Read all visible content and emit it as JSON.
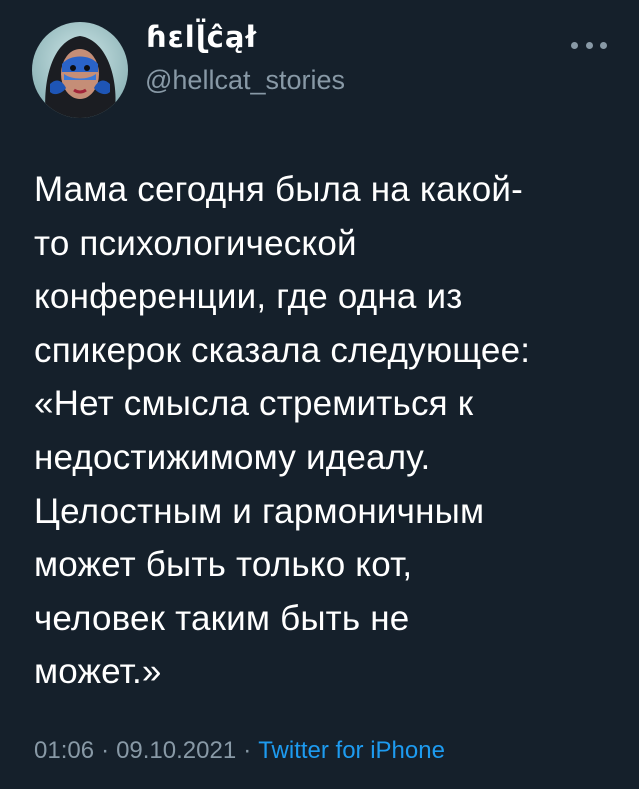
{
  "tweet": {
    "display_name": "ɦɛlɭ̈ĉął",
    "handle": "@hellcat_stories",
    "more_icon": "more-horizontal-icon",
    "text_lines": [
      "Мама сегодня была на какой-",
      "то психологической",
      "конференции, где одна из",
      "спикерок сказала следующее:",
      "«Нет смысла стремиться к",
      "недостижимому идеалу.",
      "Целостным и гармоничным",
      "может быть только кот,",
      "человек таким быть не",
      "может.»"
    ],
    "time": "01:06",
    "date": "09.10.2021",
    "separator": "·",
    "source": "Twitter for iPhone"
  },
  "colors": {
    "background": "#15202b",
    "text": "#ffffff",
    "secondary_text": "#8899a6",
    "link": "#1d9bf0"
  }
}
